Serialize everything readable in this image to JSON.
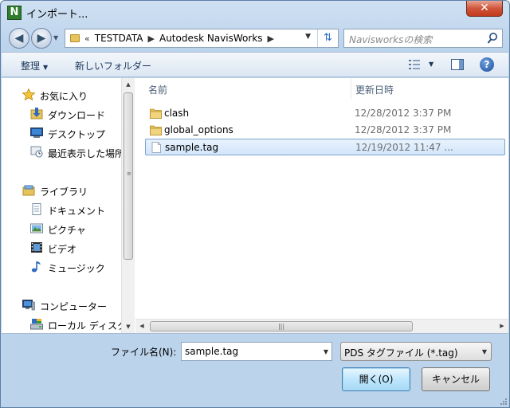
{
  "window": {
    "title": "インポート...",
    "close_label": "✕"
  },
  "nav": {
    "back_label": "◀",
    "forward_label": "▶",
    "history_arrow": "▼",
    "breadcrumb": {
      "overflow": "«",
      "items": [
        "TESTDATA",
        "Autodesk NavisWorks"
      ]
    },
    "refresh_label": "⇅"
  },
  "search": {
    "placeholder": "Navisworksの検索"
  },
  "toolbar": {
    "organize_label": "整理",
    "new_folder_label": "新しいフォルダー"
  },
  "sidebar": {
    "favorites": [
      {
        "label": "お気に入り",
        "icon": "star-icon"
      },
      {
        "label": "ダウンロード",
        "icon": "download-folder-icon"
      },
      {
        "label": "デスクトップ",
        "icon": "desktop-icon"
      },
      {
        "label": "最近表示した場所",
        "icon": "recent-places-icon"
      }
    ],
    "libraries": [
      {
        "label": "ライブラリ",
        "icon": "library-icon"
      },
      {
        "label": "ドキュメント",
        "icon": "documents-icon"
      },
      {
        "label": "ピクチャ",
        "icon": "pictures-icon"
      },
      {
        "label": "ビデオ",
        "icon": "videos-icon"
      },
      {
        "label": "ミュージック",
        "icon": "music-icon"
      }
    ],
    "computer": [
      {
        "label": "コンピューター",
        "icon": "computer-icon"
      },
      {
        "label": "ローカル ディスク",
        "icon": "local-disk-icon"
      }
    ]
  },
  "file_list": {
    "columns": [
      "名前",
      "更新日時"
    ],
    "rows": [
      {
        "name": "clash",
        "date": "12/28/2012 3:37 PM",
        "type": "folder",
        "selected": false
      },
      {
        "name": "global_options",
        "date": "12/28/2012 3:37 PM",
        "type": "folder",
        "selected": false
      },
      {
        "name": "sample.tag",
        "date": "12/19/2012 11:47 ...",
        "type": "file",
        "selected": true
      }
    ]
  },
  "filename": {
    "label": "ファイル名(N):",
    "value": "sample.tag"
  },
  "filter": {
    "value": "PDS タグファイル (*.tag)"
  },
  "buttons": {
    "open_label": "開く(O)",
    "cancel_label": "キャンセル"
  },
  "colors": {
    "chrome": "#bcd3ec",
    "selection": "#d3e6fb",
    "folder": "#e6c35c",
    "close": "#c23a1d"
  }
}
